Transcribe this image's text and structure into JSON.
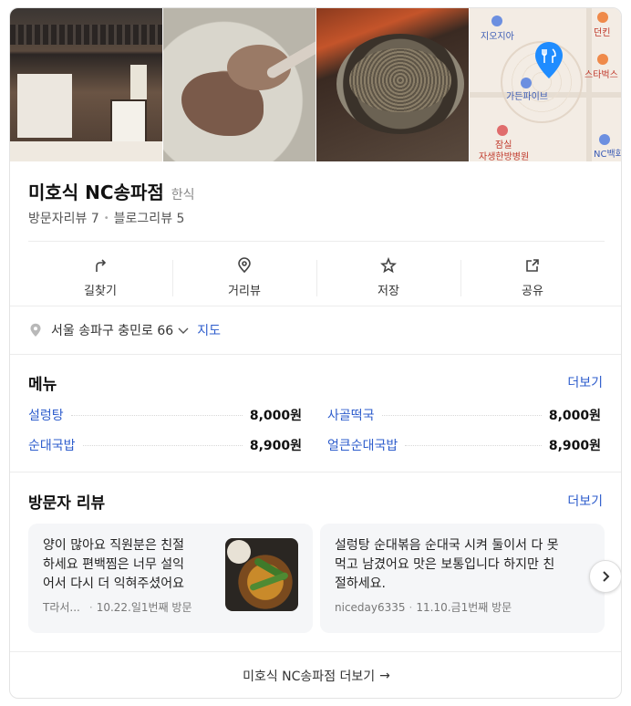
{
  "place": {
    "name": "미호식 NC송파점",
    "category": "한식",
    "visitor_reviews": "방문자리뷰 7",
    "blog_reviews": "블로그리뷰 5"
  },
  "map": {
    "labels": [
      "지오지아",
      "던킨",
      "스타벅스",
      "가든파이브",
      "잠실",
      "자생한방병원",
      "NC백화"
    ]
  },
  "actions": [
    {
      "label": "길찾기",
      "icon": "directions-icon"
    },
    {
      "label": "거리뷰",
      "icon": "map-pin-icon"
    },
    {
      "label": "저장",
      "icon": "star-icon"
    },
    {
      "label": "공유",
      "icon": "share-icon"
    }
  ],
  "address": {
    "text": "서울 송파구 충민로 66",
    "map_link": "지도"
  },
  "menu": {
    "title": "메뉴",
    "more": "더보기",
    "items": [
      {
        "name": "설렁탕",
        "price": "8,000원"
      },
      {
        "name": "사골떡국",
        "price": "8,000원"
      },
      {
        "name": "순대국밥",
        "price": "8,900원"
      },
      {
        "name": "얼큰순대국밥",
        "price": "8,900원"
      }
    ]
  },
  "reviews": {
    "title": "방문자 리뷰",
    "more": "더보기",
    "items": [
      {
        "lines": [
          "양이 많아요 직원분은 친절",
          "하세요 편백찜은 너무 설익",
          "어서 다시 더 익혀주셨어요"
        ],
        "author": "T라서...",
        "meta": "10.22.일1번째 방문"
      },
      {
        "lines": [
          "설렁탕 순대볶음 순대국 시켜 둘이서 다 못",
          "먹고 남겼어요 맛은 보통입니다 하지만 친",
          "절하세요."
        ],
        "author": "niceday6335",
        "meta": "11.10.금1번째 방문"
      }
    ]
  },
  "footer": {
    "more_link": "미호식 NC송파점 더보기",
    "arrow": "→"
  }
}
